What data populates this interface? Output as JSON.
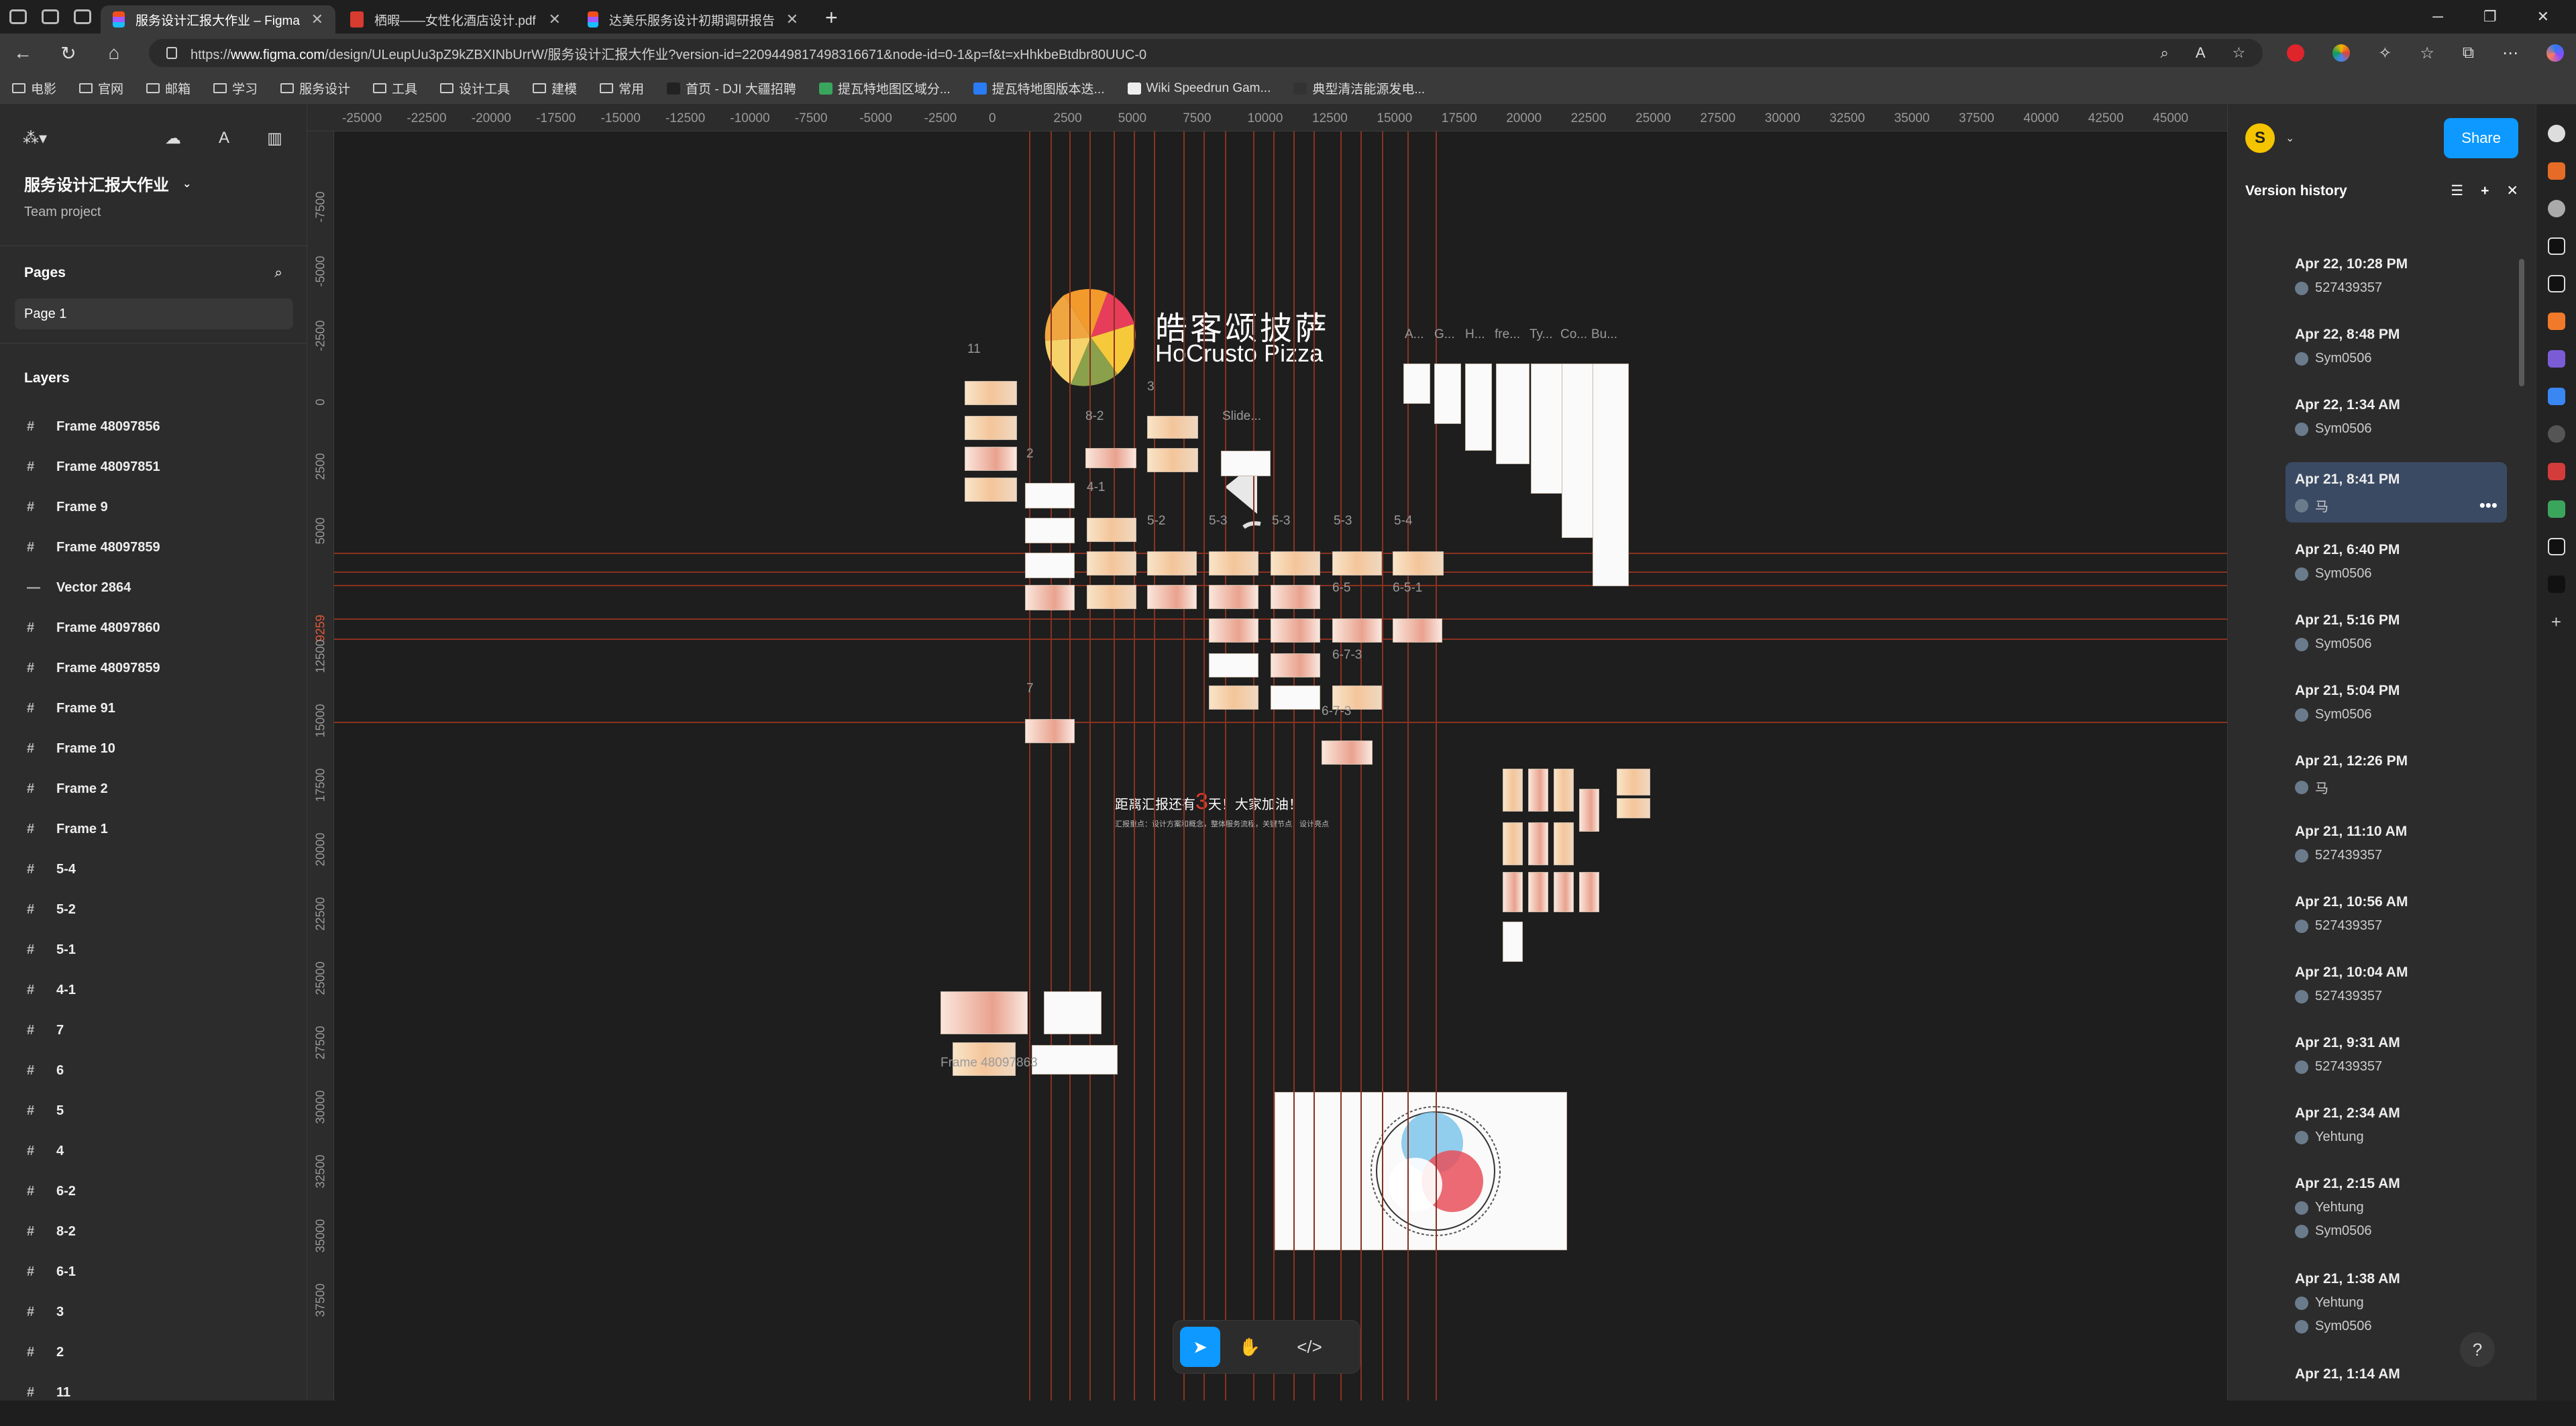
{
  "browser": {
    "tabs": [
      {
        "title": "服务设计汇报大作业 – Figma",
        "active": true,
        "kind": "figma"
      },
      {
        "title": "栖暇——女性化酒店设计.pdf",
        "active": false,
        "kind": "pdf"
      },
      {
        "title": "达美乐服务设计初期调研报告 – F",
        "active": false,
        "kind": "figma"
      }
    ],
    "url_prefix": "https://",
    "url_host": "www.figma.com",
    "url_path": "/design/ULeupUu3pZ9kZBXINbUrrW/服务设计汇报大作业?version-id=2209449817498316671&node-id=0-1&p=f&t=xHhkbeBtdbr80UUC-0",
    "bookmarks": [
      "电影",
      "官网",
      "邮箱",
      "学习",
      "服务设计",
      "工具",
      "设计工具",
      "建模",
      "常用",
      "首页 - DJI 大疆招聘",
      "提瓦特地图区域分...",
      "提瓦特地图版本迭...",
      "Wiki Speedrun Gam...",
      "典型清洁能源发电..."
    ]
  },
  "left": {
    "project_name": "服务设计汇报大作业",
    "project_sub": "Team project",
    "pages_title": "Pages",
    "page_item": "Page 1",
    "layers_title": "Layers",
    "layers": [
      "Frame 48097856",
      "Frame 48097851",
      "Frame 9",
      "Frame 48097859",
      "Vector 2864",
      "Frame 48097860",
      "Frame 48097859",
      "Frame 91",
      "Frame 10",
      "Frame 2",
      "Frame 1",
      "5-4",
      "5-2",
      "5-1",
      "4-1",
      "7",
      "6",
      "5",
      "4",
      "6-2",
      "8-2",
      "6-1",
      "3",
      "2",
      "11"
    ]
  },
  "ruler": {
    "top": [
      "-25000",
      "-22500",
      "-20000",
      "-17500",
      "-15000",
      "-12500",
      "-10000",
      "-7500",
      "-5000",
      "-2500",
      "0",
      "2500",
      "5000",
      "7500",
      "10000",
      "12500",
      "15000",
      "17500",
      "20000",
      "22500",
      "25000",
      "27500",
      "30000",
      "32500",
      "35000",
      "37500",
      "40000",
      "42500",
      "45000"
    ],
    "left": [
      "-7500",
      "-5000",
      "-2500",
      "0",
      "2500",
      "5000",
      "9259",
      "12500",
      "15000",
      "17500",
      "20000",
      "22500",
      "25000",
      "27500",
      "30000",
      "32500",
      "35000",
      "37500"
    ]
  },
  "canvas": {
    "logo_cn": "皓客颂披萨",
    "logo_en": "HoCrusto Pizza",
    "countdown_pre": "距离汇报还有",
    "countdown_num": "3",
    "countdown_post": "天！大家加油！",
    "countdown_sub": "汇报重点：设计方案和概念，整体服务流程，关键节点，设计亮点",
    "frame_labels": [
      "11",
      "2",
      "8-2",
      "3",
      "Slide...",
      "4-1",
      "5-2",
      "5-3",
      "5-3",
      "5-3",
      "5-4",
      "6-5",
      "6-5-1",
      "6-7-3",
      "6-7-3",
      "7",
      "A...",
      "G...",
      "H...",
      "fre...",
      "Ty...",
      "Co...",
      "Bu...",
      "Frame 48097863"
    ]
  },
  "toolbar": {
    "move": "move-tool",
    "hand": "hand-tool",
    "code": "dev-mode"
  },
  "right": {
    "avatar": "S",
    "share": "Share",
    "panel_title": "Version history",
    "versions": [
      {
        "date": "Apr 22, 10:28 PM",
        "users": [
          "527439357"
        ]
      },
      {
        "date": "Apr 22, 8:48 PM",
        "users": [
          "Sym0506"
        ]
      },
      {
        "date": "Apr 22, 1:34 AM",
        "users": [
          "Sym0506"
        ]
      },
      {
        "date": "Apr 21, 8:41 PM",
        "users": [
          "马"
        ],
        "selected": true
      },
      {
        "date": "Apr 21, 6:40 PM",
        "users": [
          "Sym0506"
        ]
      },
      {
        "date": "Apr 21, 5:16 PM",
        "users": [
          "Sym0506"
        ]
      },
      {
        "date": "Apr 21, 5:04 PM",
        "users": [
          "Sym0506"
        ]
      },
      {
        "date": "Apr 21, 12:26 PM",
        "users": [
          "马"
        ]
      },
      {
        "date": "Apr 21, 11:10 AM",
        "users": [
          "527439357"
        ]
      },
      {
        "date": "Apr 21, 10:56 AM",
        "users": [
          "527439357"
        ]
      },
      {
        "date": "Apr 21, 10:04 AM",
        "users": [
          "527439357"
        ]
      },
      {
        "date": "Apr 21, 9:31 AM",
        "users": [
          "527439357"
        ]
      },
      {
        "date": "Apr 21, 2:34 AM",
        "users": [
          "Yehtung"
        ]
      },
      {
        "date": "Apr 21, 2:15 AM",
        "users": [
          "Yehtung",
          "Sym0506"
        ]
      },
      {
        "date": "Apr 21, 1:38 AM",
        "users": [
          "Yehtung",
          "Sym0506"
        ]
      },
      {
        "date": "Apr 21, 1:14 AM",
        "users": []
      }
    ],
    "help": "?"
  },
  "colors": {
    "accent": "#0d99ff",
    "guide": "#8a3220",
    "selected_version": "#3b4a63"
  }
}
